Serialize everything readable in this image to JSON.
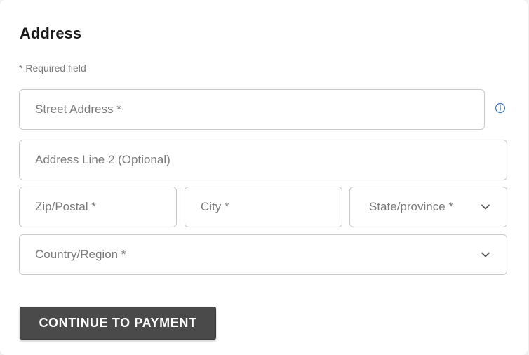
{
  "form": {
    "title": "Address",
    "required_note": "*  Required field",
    "street": {
      "placeholder": "Street Address *",
      "value": ""
    },
    "address2": {
      "placeholder": "Address Line 2 (Optional)",
      "value": ""
    },
    "zip": {
      "placeholder": "Zip/Postal *",
      "value": ""
    },
    "city": {
      "placeholder": "City *",
      "value": ""
    },
    "state": {
      "placeholder": "State/province *",
      "selected": ""
    },
    "country": {
      "placeholder": "Country/Region *",
      "selected": ""
    },
    "submit_label": "CONTINUE TO PAYMENT"
  },
  "icons": {
    "info": "info-circle-icon",
    "chevron": "chevron-down-icon"
  },
  "colors": {
    "button_bg": "#4a4a4a",
    "info_icon": "#3a78c2",
    "border": "#c9c9c9",
    "placeholder": "#7b7b7b"
  }
}
